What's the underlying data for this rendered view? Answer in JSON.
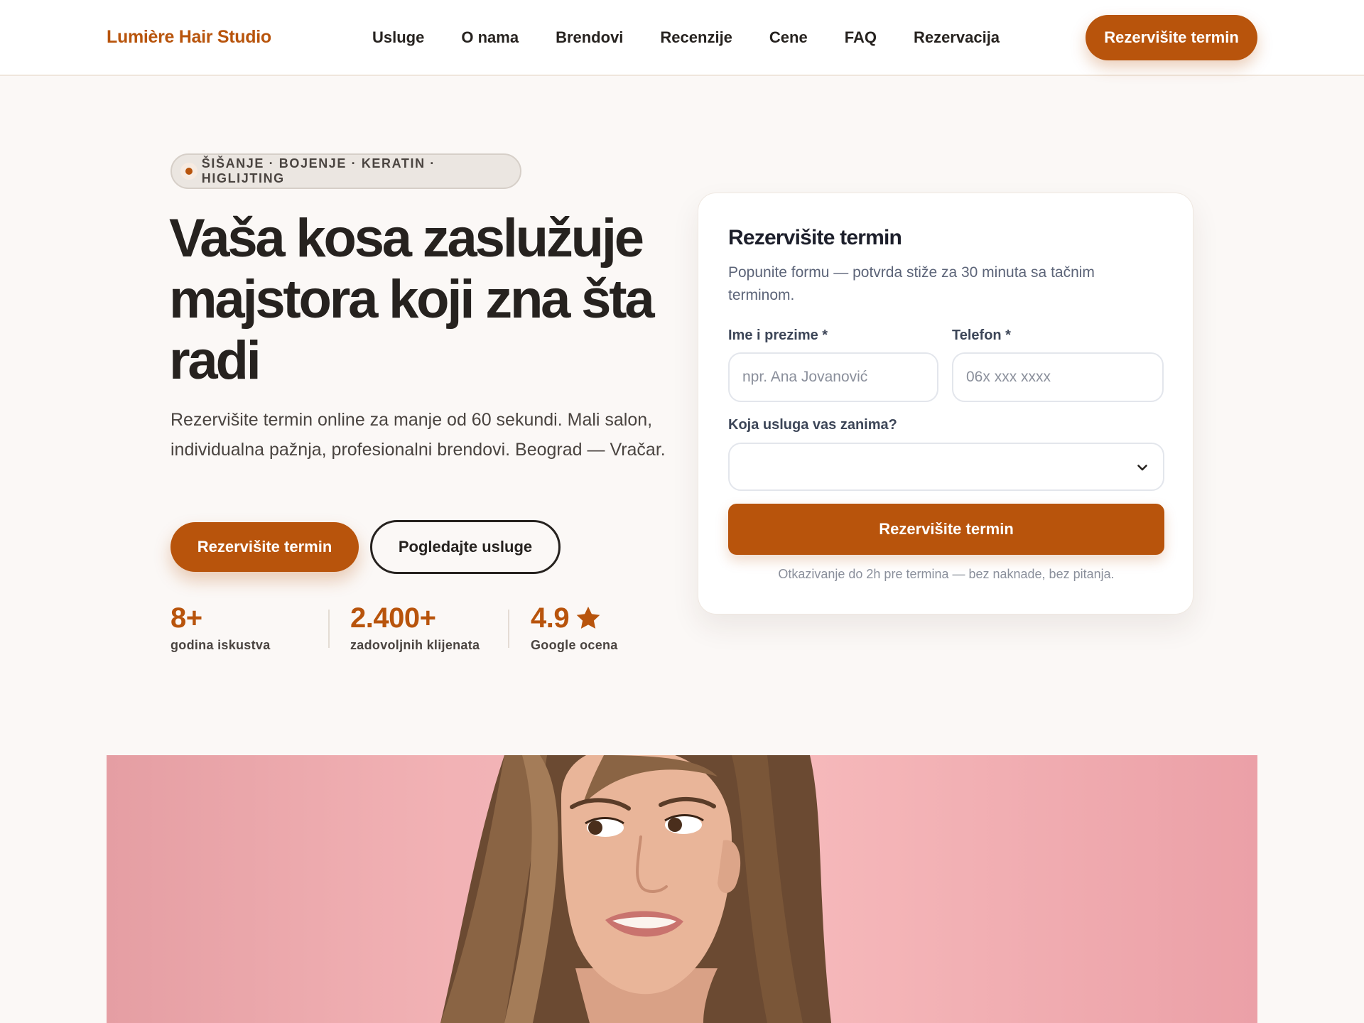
{
  "header": {
    "brand": "Lumière Hair Studio",
    "nav": [
      "Usluge",
      "O nama",
      "Brendovi",
      "Recenzije",
      "Cene",
      "FAQ",
      "Rezervacija"
    ],
    "cta": "Rezervišite termin"
  },
  "hero": {
    "badge": "ŠIŠANJE · BOJENJE · KERATIN · HIGLIJTING",
    "title": "Vaša kosa zaslužuje majstora koji zna šta radi",
    "subtitle": "Rezervišite termin online za manje od 60 sekundi. Mali salon, individualna pažnja, profesionalni brendovi. Beograd — Vračar.",
    "primary_button": "Rezervišite termin",
    "secondary_button": "Pogledajte usluge",
    "stats": [
      {
        "value": "8+",
        "label": "godina iskustva"
      },
      {
        "value": "2.400+",
        "label": "zadovoljnih klijenata"
      },
      {
        "value": "4.9",
        "label": "Google ocena",
        "icon": "star-icon"
      }
    ]
  },
  "booking": {
    "title": "Rezervišite termin",
    "description": "Popunite formu — potvrda stiže za 30 minuta sa tačnim terminom.",
    "name_label": "Ime i prezime *",
    "name_placeholder": "npr. Ana Jovanović",
    "phone_label": "Telefon *",
    "phone_placeholder": "06x xxx xxxx",
    "service_label": "Koja usluga vas zanima?",
    "service_value": "",
    "submit": "Rezervišite termin",
    "note": "Otkazivanje do 2h pre termina — bez naknade, bez pitanja."
  },
  "colors": {
    "accent": "#b8540c",
    "text_dark": "#26221f",
    "page_bg": "#fbf8f6",
    "image_bg": "#f4b3b6"
  }
}
